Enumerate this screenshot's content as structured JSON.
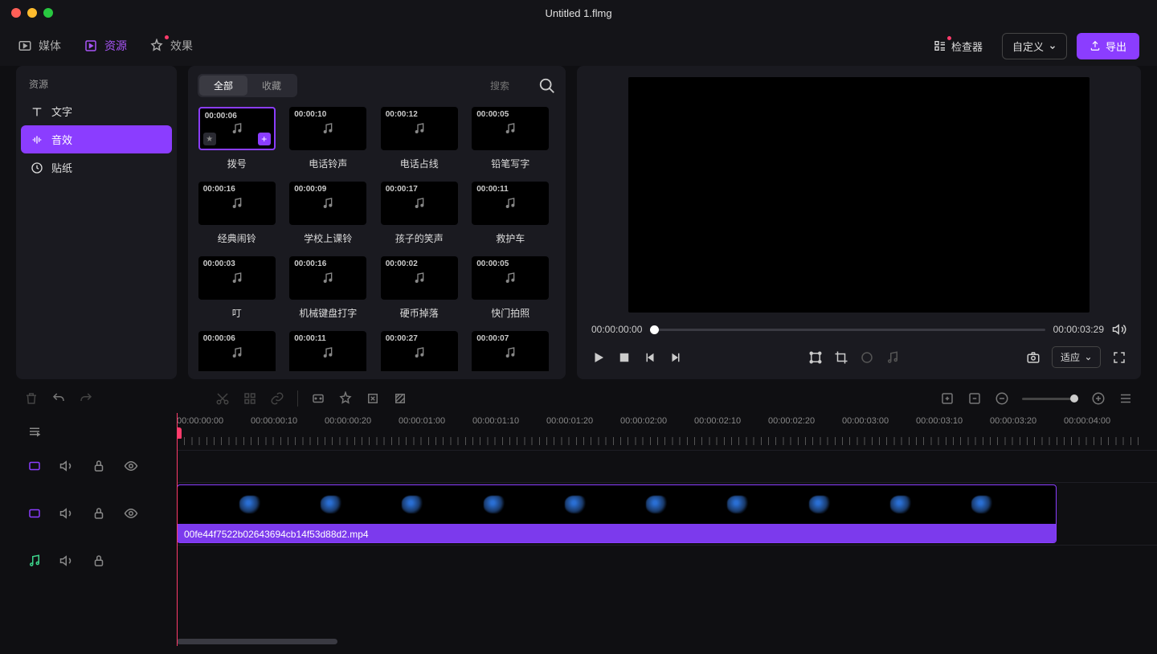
{
  "window": {
    "title": "Untitled 1.flmg"
  },
  "topTabs": {
    "media": "媒体",
    "resources": "资源",
    "effects": "效果"
  },
  "topRight": {
    "inspector": "检查器",
    "custom": "自定义",
    "export": "导出"
  },
  "sidebar": {
    "title": "资源",
    "text": "文字",
    "audio": "音效",
    "sticker": "贴纸"
  },
  "filters": {
    "all": "全部",
    "fav": "收藏"
  },
  "search": {
    "placeholder": "搜索"
  },
  "assets": [
    {
      "dur": "00:00:06",
      "name": "拨号",
      "selected": true
    },
    {
      "dur": "00:00:10",
      "name": "电话铃声"
    },
    {
      "dur": "00:00:12",
      "name": "电话占线"
    },
    {
      "dur": "00:00:05",
      "name": "铅笔写字"
    },
    {
      "dur": "00:00:16",
      "name": "经典闹铃"
    },
    {
      "dur": "00:00:09",
      "name": "学校上课铃"
    },
    {
      "dur": "00:00:17",
      "name": "孩子的笑声"
    },
    {
      "dur": "00:00:11",
      "name": "救护车"
    },
    {
      "dur": "00:00:03",
      "name": "叮"
    },
    {
      "dur": "00:00:16",
      "name": "机械键盘打字"
    },
    {
      "dur": "00:00:02",
      "name": "硬币掉落"
    },
    {
      "dur": "00:00:05",
      "name": "快门拍照"
    },
    {
      "dur": "00:00:06",
      "name": ""
    },
    {
      "dur": "00:00:11",
      "name": ""
    },
    {
      "dur": "00:00:27",
      "name": ""
    },
    {
      "dur": "00:00:07",
      "name": ""
    }
  ],
  "preview": {
    "current": "00:00:00:00",
    "total": "00:00:03:29",
    "fit": "适应"
  },
  "ruler": [
    "00:00:00:00",
    "00:00:00:10",
    "00:00:00:20",
    "00:00:01:00",
    "00:00:01:10",
    "00:00:01:20",
    "00:00:02:00",
    "00:00:02:10",
    "00:00:02:20",
    "00:00:03:00",
    "00:00:03:10",
    "00:00:03:20",
    "00:00:04:00"
  ],
  "clip": {
    "filename": "00fe44f7522b02643694cb14f53d88d2.mp4"
  }
}
